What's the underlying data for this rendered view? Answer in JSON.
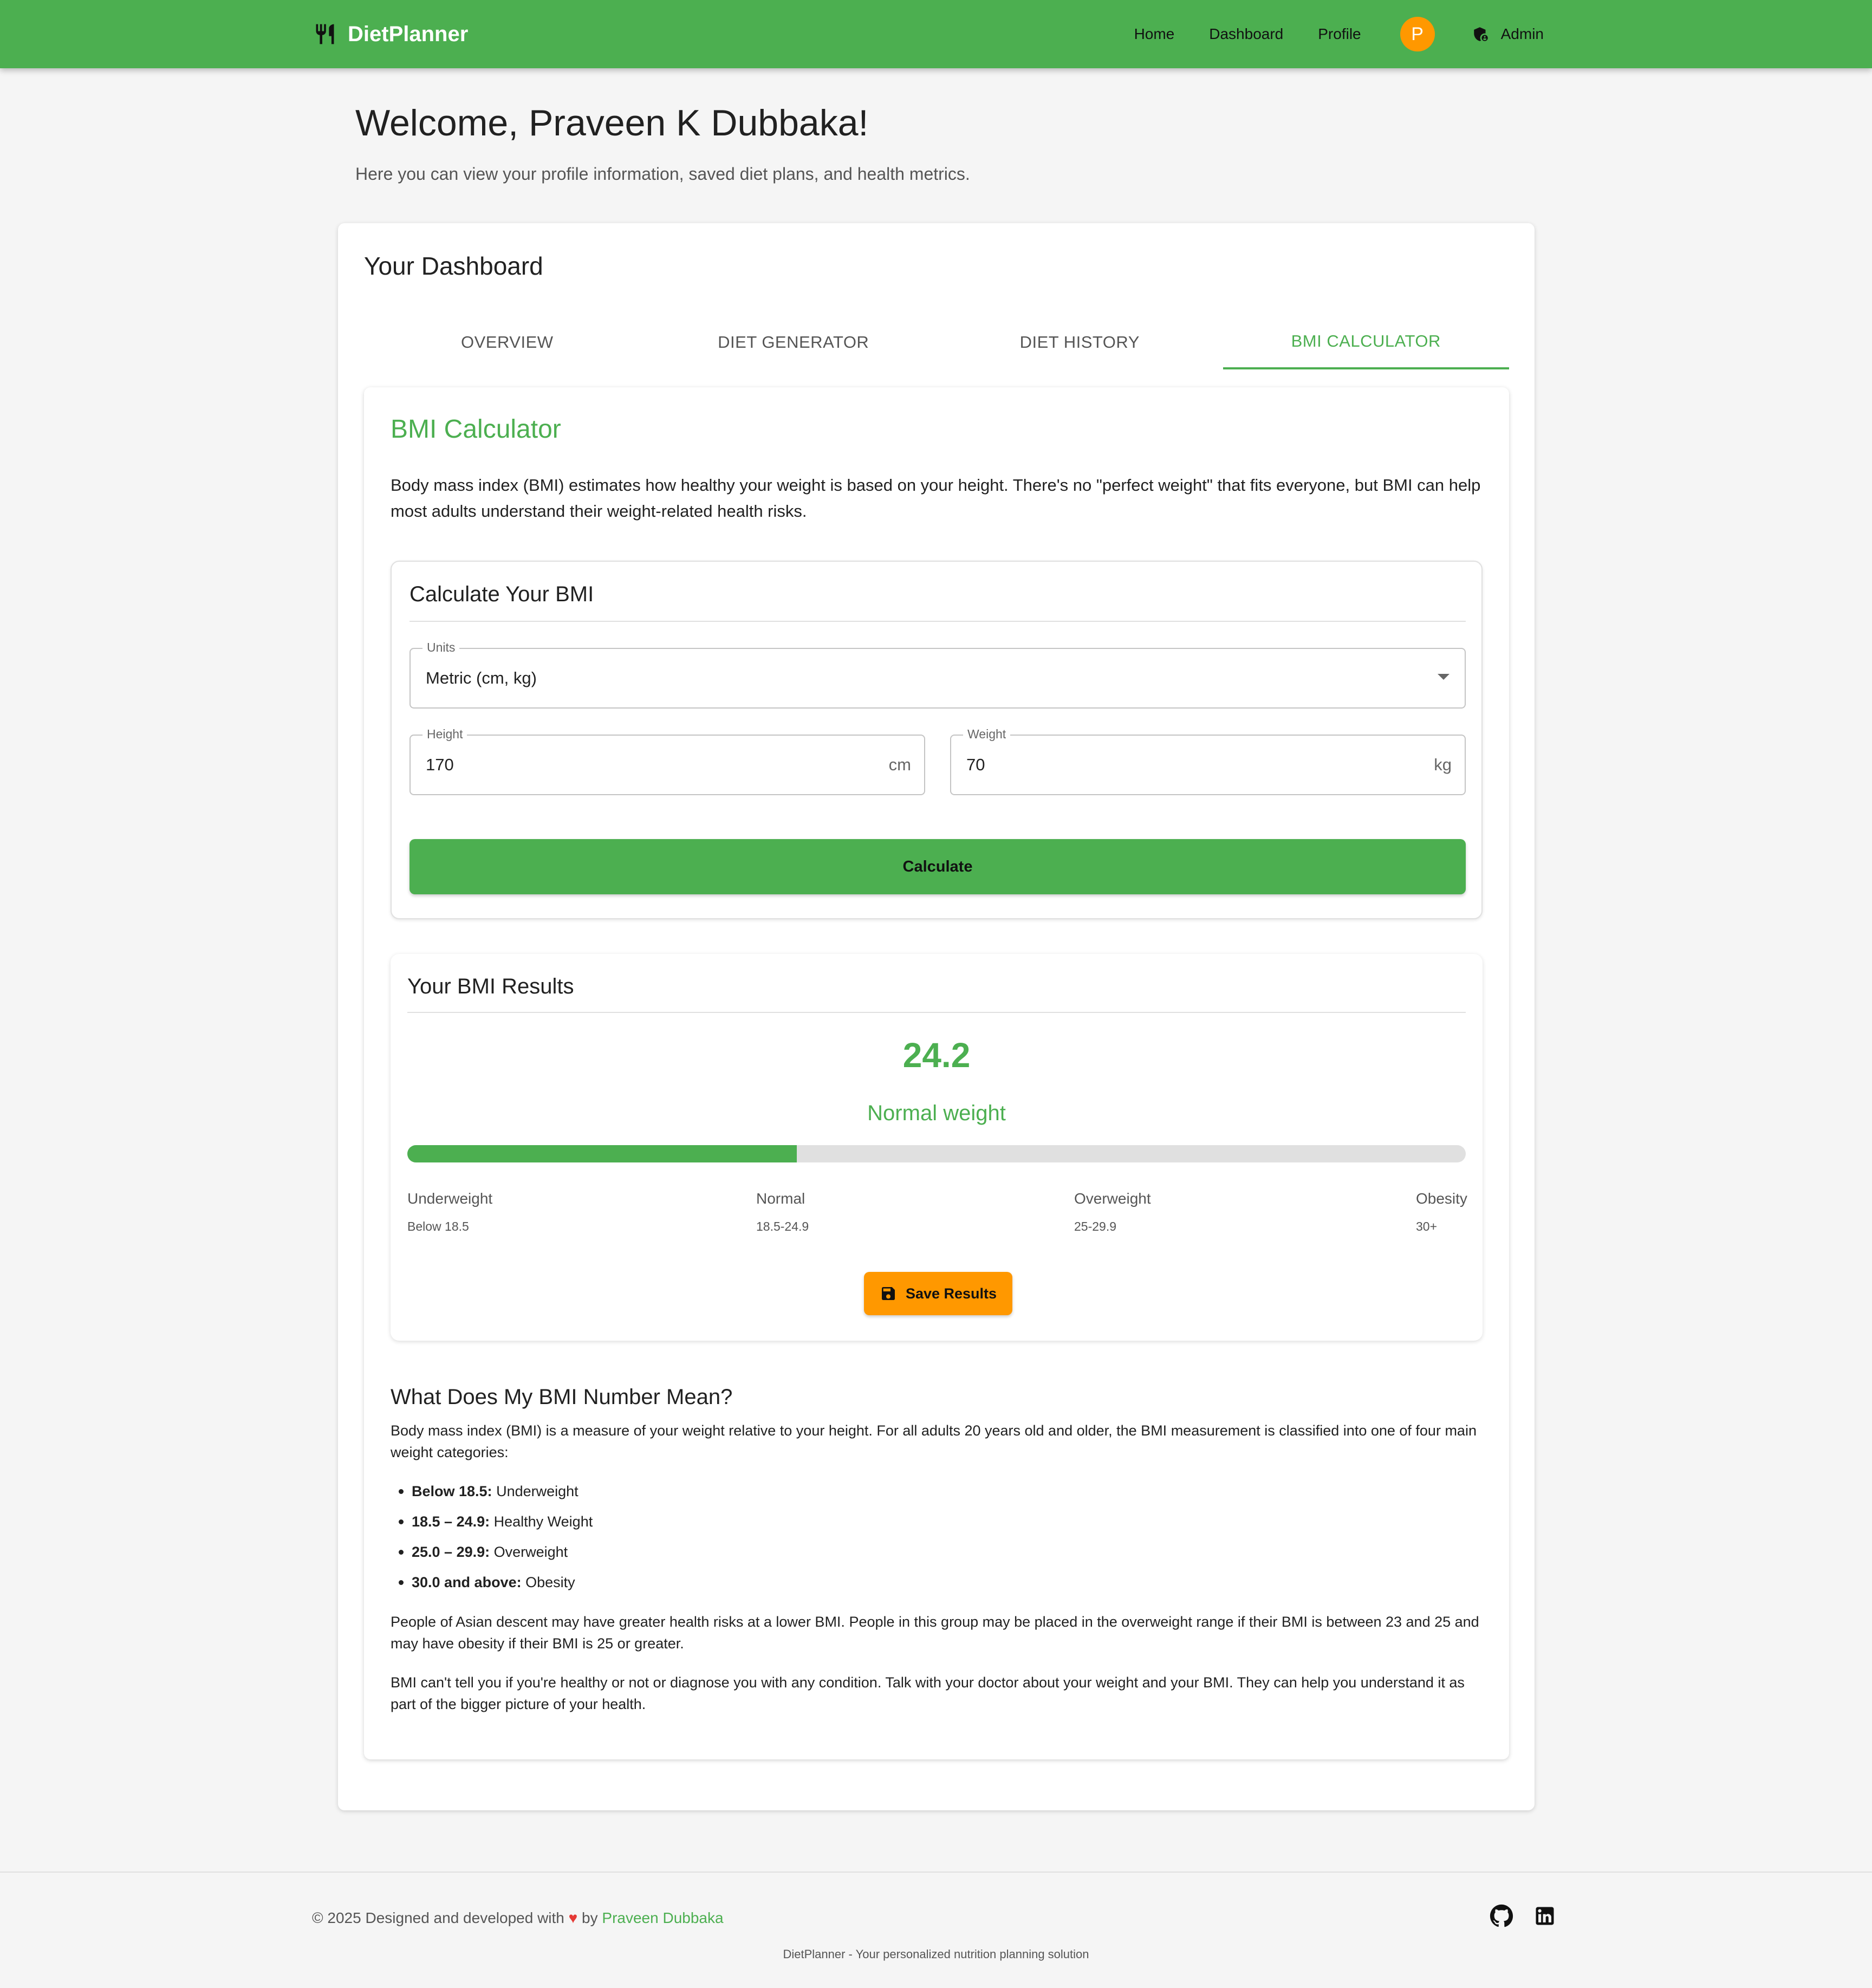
{
  "header": {
    "brand": "DietPlanner",
    "nav": {
      "home": "Home",
      "dashboard": "Dashboard",
      "profile": "Profile"
    },
    "avatar_initial": "P",
    "admin_label": "Admin",
    "brand_icon": "restaurant-icon",
    "admin_icon": "admin-shield-icon"
  },
  "page": {
    "welcome": "Welcome, Praveen K Dubbaka!",
    "subtitle": "Here you can view your profile information, saved diet plans, and health metrics."
  },
  "dashboard": {
    "title": "Your Dashboard",
    "tabs": [
      {
        "label": "Overview",
        "active": false
      },
      {
        "label": "Diet Generator",
        "active": false
      },
      {
        "label": "Diet History",
        "active": false
      },
      {
        "label": "BMI Calculator",
        "active": true
      }
    ]
  },
  "bmi": {
    "title": "BMI Calculator",
    "intro": "Body mass index (BMI) estimates how healthy your weight is based on your height. There's no \"perfect weight\" that fits everyone, but BMI can help most adults understand their weight-related health risks.",
    "calc": {
      "title": "Calculate Your BMI",
      "units_label": "Units",
      "units_value": "Metric (cm, kg)",
      "height_label": "Height",
      "height_value": "170",
      "height_unit": "cm",
      "weight_label": "Weight",
      "weight_value": "70",
      "weight_unit": "kg",
      "button": "Calculate"
    },
    "results": {
      "title": "Your BMI Results",
      "value": "24.2",
      "category": "Normal weight",
      "progress_fraction": 0.368,
      "scale": [
        {
          "name": "Underweight",
          "range": "Below 18.5"
        },
        {
          "name": "Normal",
          "range": "18.5-24.9"
        },
        {
          "name": "Overweight",
          "range": "25-29.9"
        },
        {
          "name": "Obesity",
          "range": "30+"
        }
      ],
      "save_button": "Save Results",
      "save_icon": "save-icon"
    },
    "meaning": {
      "title": "What Does My BMI Number Mean?",
      "p1": "Body mass index (BMI) is a measure of your weight relative to your height. For all adults 20 years old and older, the BMI measurement is classified into one of four main weight categories:",
      "list": [
        {
          "bold": "Below 18.5:",
          "text": " Underweight"
        },
        {
          "bold": "18.5 – 24.9:",
          "text": " Healthy Weight"
        },
        {
          "bold": "25.0 – 29.9:",
          "text": " Overweight"
        },
        {
          "bold": "30.0 and above:",
          "text": " Obesity"
        }
      ],
      "p2": "People of Asian descent may have greater health risks at a lower BMI. People in this group may be placed in the overweight range if their BMI is between 23 and 25 and may have obesity if their BMI is 25 or greater.",
      "p3": "BMI can't tell you if you're healthy or not or diagnose you with any condition. Talk with your doctor about your weight and your BMI. They can help you understand it as part of the bigger picture of your health."
    }
  },
  "footer": {
    "copy_prefix": "© 2025 Designed and developed with",
    "heart": "♥",
    "by": "by",
    "author": "Praveen Dubbaka",
    "tagline": "DietPlanner - Your personalized nutrition planning solution",
    "icons": [
      "github-icon",
      "linkedin-icon"
    ]
  },
  "colors": {
    "primary": "#4caf50",
    "accent": "#ff9800",
    "heart": "#e53935"
  }
}
